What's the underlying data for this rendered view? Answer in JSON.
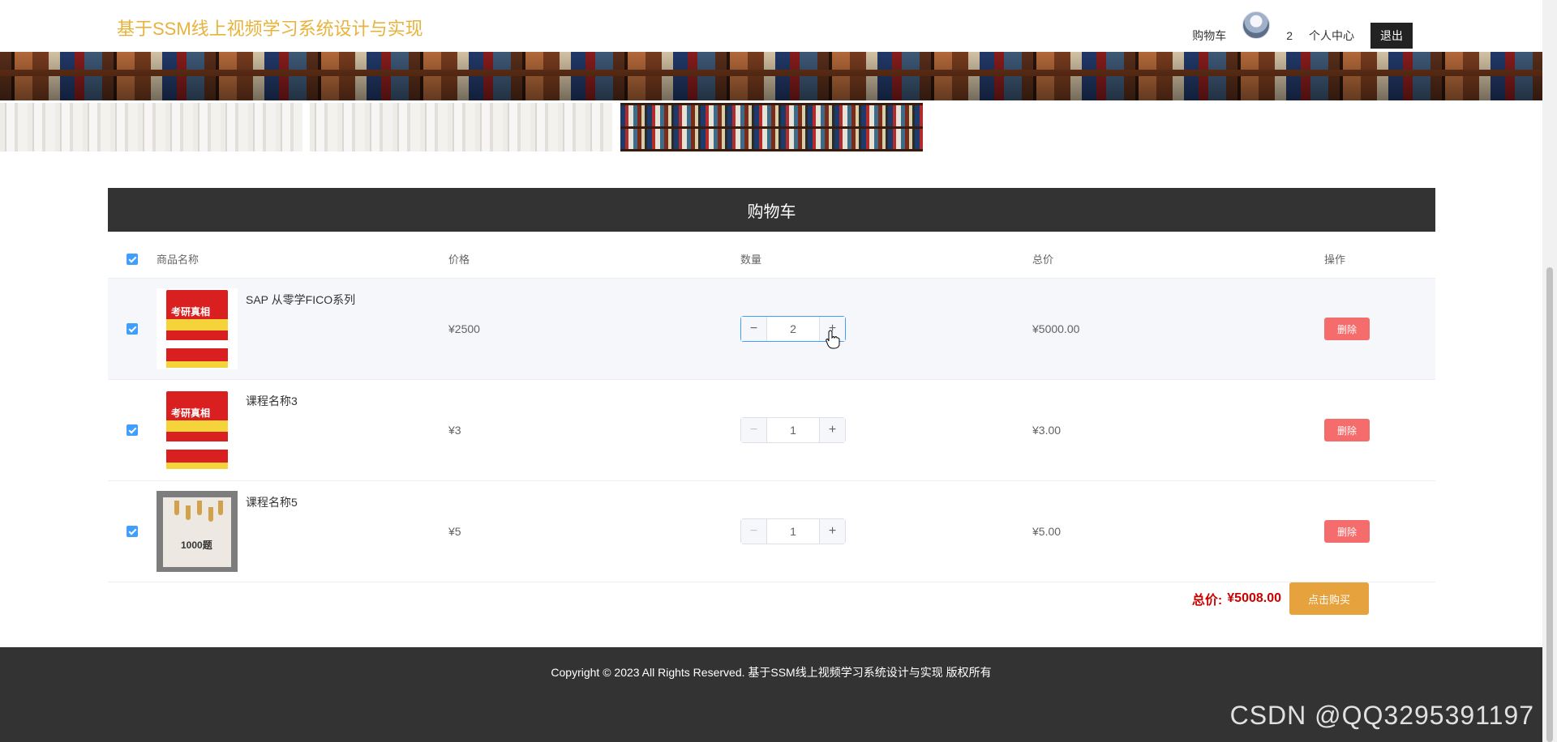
{
  "header": {
    "site_title": "基于SSM线上视频学习系统设计与实现",
    "nav": {
      "cart": "购物车",
      "count": "2",
      "user_center": "个人中心",
      "logout": "退出"
    }
  },
  "cart": {
    "title": "购物车",
    "columns": [
      "商品名称",
      "价格",
      "数量",
      "总价",
      "操作"
    ],
    "items": [
      {
        "name": "SAP 从零学FICO系列",
        "price": "¥2500",
        "quantity": "2",
        "total": "¥5000.00",
        "delete": "删除"
      },
      {
        "name": "课程名称3",
        "price": "¥3",
        "quantity": "1",
        "total": "¥3.00",
        "delete": "删除"
      },
      {
        "name": "课程名称5",
        "price": "¥5",
        "quantity": "1",
        "total": "¥5.00",
        "delete": "删除"
      }
    ],
    "summary": {
      "label": "总价:",
      "value": "¥5008.00",
      "buy": "点击购买"
    }
  },
  "book_cover": {
    "title": "考研真相",
    "num": "1000题"
  },
  "footer": {
    "copyright": "Copyright © 2023 All Rights Reserved. 基于SSM线上视频学习系统设计与实现 版权所有",
    "watermark": "CSDN @QQ3295391197"
  },
  "colors": {
    "brand": "#e8b23b",
    "primary": "#409eff",
    "danger": "#f56c6c",
    "warning": "#e6a23c",
    "dark": "#333333",
    "total": "#cc0000"
  },
  "icons": [
    "checkbox-checked-icon",
    "minus-icon",
    "plus-icon",
    "hand-cursor-icon"
  ]
}
